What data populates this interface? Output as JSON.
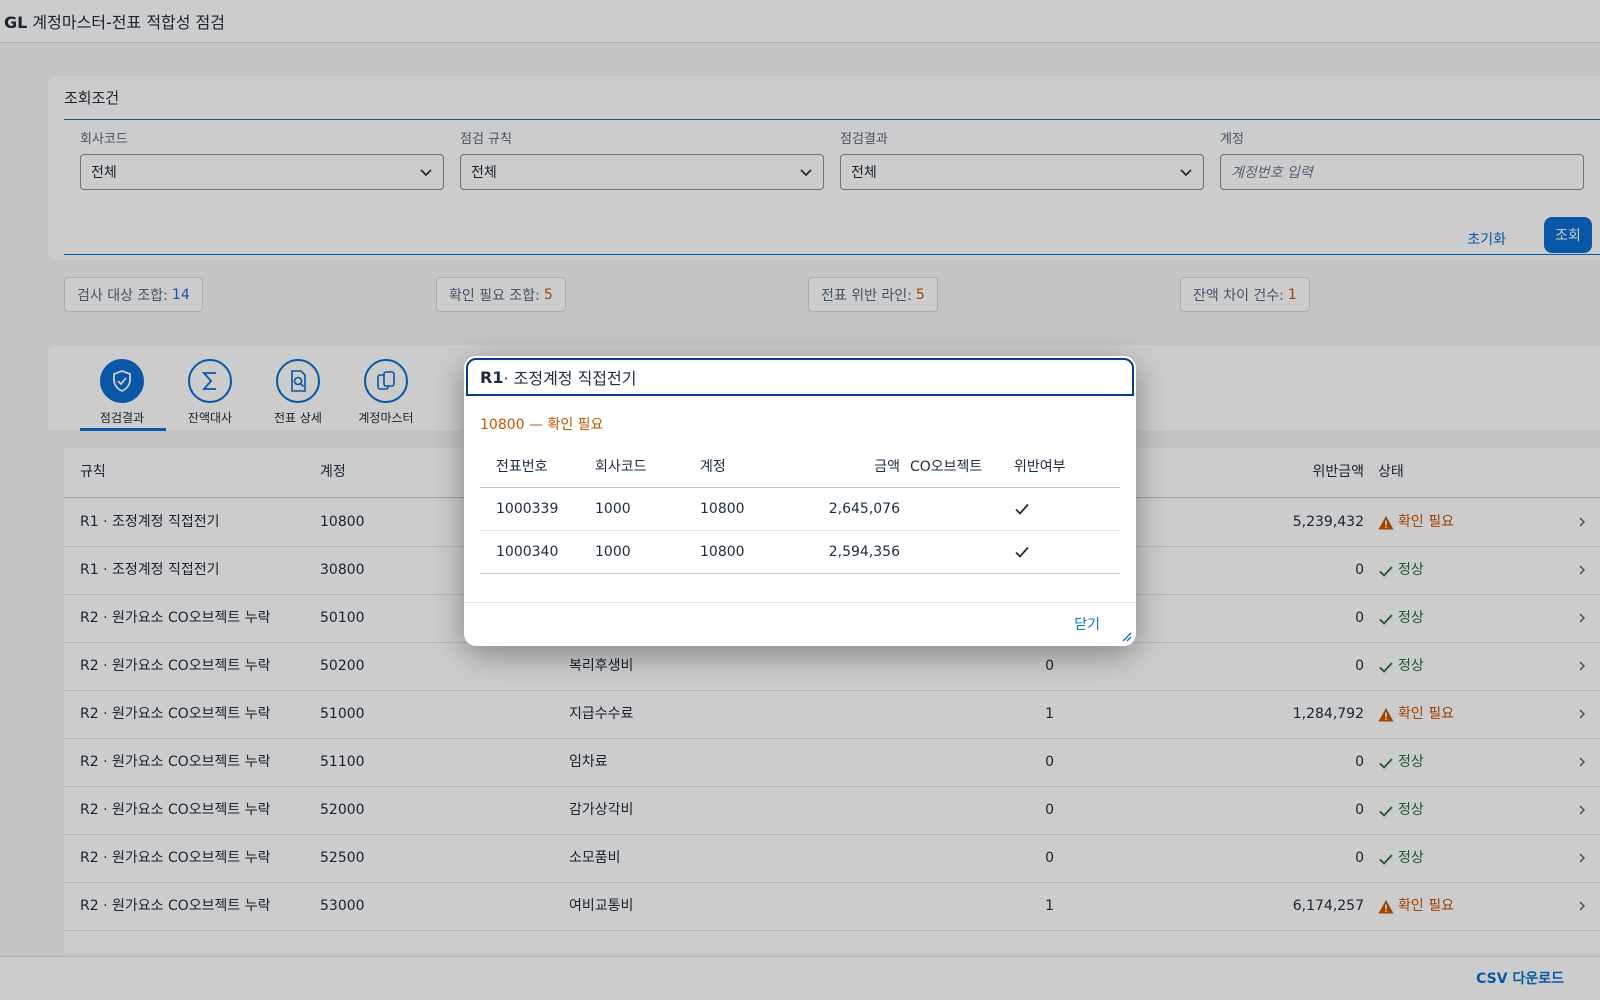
{
  "app": {
    "title_bold": "GL",
    "title_rest": " 계정마스터-전표 적합성 점검"
  },
  "filter": {
    "title": "조회조건",
    "fields": [
      {
        "label": "회사코드",
        "value": "전체"
      },
      {
        "label": "점검 규칙",
        "value": "전체"
      },
      {
        "label": "점검결과",
        "value": "전체"
      },
      {
        "label": "계정",
        "placeholder": "계정번호 입력"
      }
    ],
    "reset_label": "초기화",
    "search_label": "조회"
  },
  "kpis": [
    {
      "label": "검사 대상 조합:",
      "value": "14"
    },
    {
      "label": "확인 필요 조합:",
      "value": "5"
    },
    {
      "label": "전표 위반 라인:",
      "value": "5"
    },
    {
      "label": "잔액 차이 건수:",
      "value": "1"
    }
  ],
  "tabs": [
    {
      "label": "점검결과",
      "icon": "shield-check-icon"
    },
    {
      "label": "잔액대사",
      "icon": "sigma-icon"
    },
    {
      "label": "전표 상세",
      "icon": "document-search-icon"
    },
    {
      "label": "계정마스터",
      "icon": "documents-icon"
    }
  ],
  "table": {
    "headers": {
      "rule": "규칙",
      "account": "계정",
      "amount": "위반금액",
      "status": "상태"
    },
    "rows": [
      {
        "rule": "R1 · 조정계정 직접전기",
        "account": "10800",
        "name": "",
        "count": "",
        "amount": "5,239,432",
        "status": "확인 필요",
        "level": "warn"
      },
      {
        "rule": "R1 · 조정계정 직접전기",
        "account": "30800",
        "name": "",
        "count": "",
        "amount": "0",
        "status": "정상",
        "level": "ok"
      },
      {
        "rule": "R2 · 원가요소 CO오브젝트 누락",
        "account": "50100",
        "name": "",
        "count": "",
        "amount": "0",
        "status": "정상",
        "level": "ok"
      },
      {
        "rule": "R2 · 원가요소 CO오브젝트 누락",
        "account": "50200",
        "name": "복리후생비",
        "count": "0",
        "amount": "0",
        "status": "정상",
        "level": "ok"
      },
      {
        "rule": "R2 · 원가요소 CO오브젝트 누락",
        "account": "51000",
        "name": "지급수수료",
        "count": "1",
        "amount": "1,284,792",
        "status": "확인 필요",
        "level": "warn"
      },
      {
        "rule": "R2 · 원가요소 CO오브젝트 누락",
        "account": "51100",
        "name": "임차료",
        "count": "0",
        "amount": "0",
        "status": "정상",
        "level": "ok"
      },
      {
        "rule": "R2 · 원가요소 CO오브젝트 누락",
        "account": "52000",
        "name": "감가상각비",
        "count": "0",
        "amount": "0",
        "status": "정상",
        "level": "ok"
      },
      {
        "rule": "R2 · 원가요소 CO오브젝트 누락",
        "account": "52500",
        "name": "소모품비",
        "count": "0",
        "amount": "0",
        "status": "정상",
        "level": "ok"
      },
      {
        "rule": "R2 · 원가요소 CO오브젝트 누락",
        "account": "53000",
        "name": "여비교통비",
        "count": "1",
        "amount": "6,174,257",
        "status": "확인 필요",
        "level": "warn"
      }
    ]
  },
  "footer": {
    "csv_label": "CSV 다운로드"
  },
  "dialog": {
    "title_bold": "R1",
    "title_rest": " · 조정계정 직접전기",
    "subtitle": "10800 — 확인 필요",
    "headers": {
      "doc_no": "전표번호",
      "company": "회사코드",
      "account": "계정",
      "amount": "금액",
      "co_object": "CO오브젝트",
      "violation": "위반여부"
    },
    "rows": [
      {
        "doc_no": "1000339",
        "company": "1000",
        "account": "10800",
        "amount": "2,645,076",
        "co_object": "",
        "violation": true
      },
      {
        "doc_no": "1000340",
        "company": "1000",
        "account": "10800",
        "amount": "2,594,356",
        "co_object": "",
        "violation": true
      }
    ],
    "close_label": "닫기"
  },
  "colors": {
    "accent": "#0a6ed1",
    "warning": "#c35500",
    "success": "#256f3a"
  }
}
